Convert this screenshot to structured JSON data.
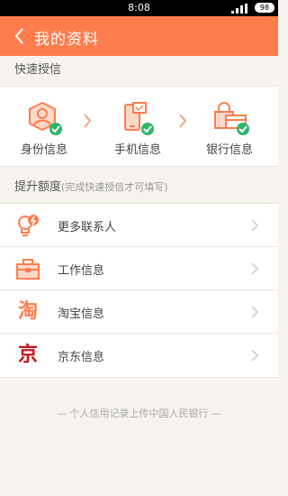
{
  "status_bar": {
    "time": "8:08",
    "battery": "98"
  },
  "header": {
    "title": "我的资料"
  },
  "quick_section": {
    "title": "快速授信",
    "items": [
      {
        "label": "身份信息",
        "icon": "id-icon"
      },
      {
        "label": "手机信息",
        "icon": "phone-icon"
      },
      {
        "label": "银行信息",
        "icon": "bank-icon"
      }
    ]
  },
  "limit_section": {
    "title": "提升额度",
    "note": "(完成快速授信才可填写)",
    "items": [
      {
        "label": "更多联系人",
        "icon": "contacts-icon"
      },
      {
        "label": "工作信息",
        "icon": "briefcase-icon"
      },
      {
        "label": "淘宝信息",
        "icon": "taobao-icon",
        "glyph": "淘"
      },
      {
        "label": "京东信息",
        "icon": "jd-icon",
        "glyph": "京"
      }
    ]
  },
  "footer": {
    "text": "— 个人信用记录上传中国人民银行 —"
  },
  "colors": {
    "accent": "#ff7d4d",
    "check": "#2fb56a",
    "jd": "#c9151e"
  }
}
